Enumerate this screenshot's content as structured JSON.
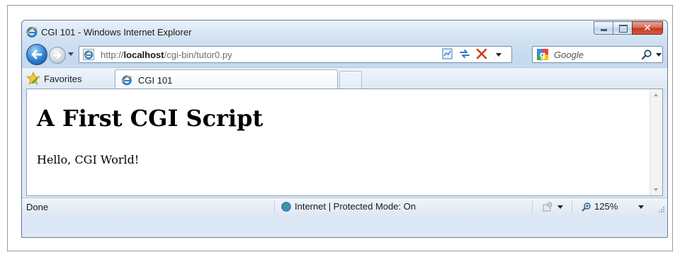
{
  "window": {
    "title": "CGI 101 - Windows Internet Explorer",
    "close_glyph": "✕"
  },
  "navbar": {
    "url_prefix": "http://",
    "url_host": "localhost",
    "url_path": "/cgi-bin/tutor0.py",
    "search_placeholder": "Google"
  },
  "toolbar": {
    "favorites_label": "Favorites",
    "tab_label": "CGI 101"
  },
  "page": {
    "heading": "A First CGI Script",
    "body": "Hello, CGI World!"
  },
  "statusbar": {
    "status": "Done",
    "zone": "Internet | Protected Mode: On",
    "zoom": "125%"
  },
  "icons": {
    "app": "ie-logo-icon",
    "back": "back-arrow-icon",
    "forward": "forward-arrow-icon",
    "compat": "compatibility-view-icon",
    "refresh": "refresh-icon",
    "stop": "stop-icon",
    "search_provider": "google-icon",
    "search": "search-icon",
    "favorites": "favorites-star-icon",
    "zone": "globe-icon",
    "addons": "addons-icon",
    "zoom": "zoom-icon"
  },
  "colors": {
    "chrome": "#c4d8ee",
    "close_button": "#c2391f",
    "back_button": "#2d7fd0"
  }
}
